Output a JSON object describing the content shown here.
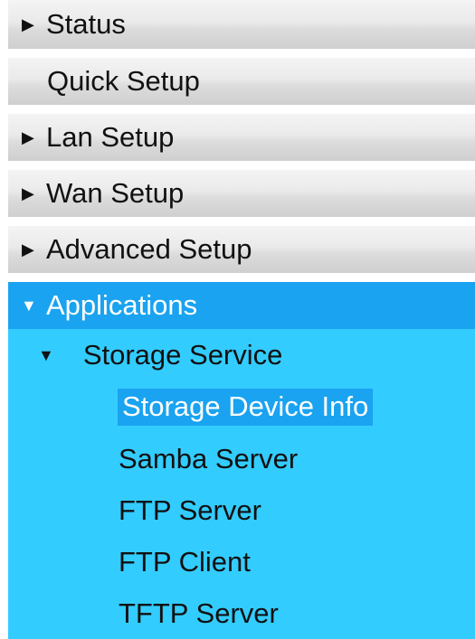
{
  "menu": {
    "items": [
      {
        "label": "Status",
        "expanded": false
      },
      {
        "label": "Quick Setup",
        "expanded": null
      },
      {
        "label": "Lan Setup",
        "expanded": false
      },
      {
        "label": "Wan Setup",
        "expanded": false
      },
      {
        "label": "Advanced Setup",
        "expanded": false
      }
    ],
    "applications": {
      "label": "Applications",
      "expanded": true,
      "storage_service": {
        "label": "Storage Service",
        "expanded": true,
        "children": [
          {
            "label": "Storage Device Info",
            "selected": true
          },
          {
            "label": "Samba Server",
            "selected": false
          },
          {
            "label": "FTP Server",
            "selected": false
          },
          {
            "label": "FTP Client",
            "selected": false
          },
          {
            "label": "TFTP Server",
            "selected": false
          }
        ]
      }
    }
  },
  "icons": {
    "collapsed": "triangle-right-icon",
    "expanded": "triangle-down-icon"
  },
  "colors": {
    "menu_gray": "#dcdcdc",
    "applications_bg": "#33ccff",
    "selected_bg": "#1aa3f0",
    "selected_text": "#ffffff"
  }
}
